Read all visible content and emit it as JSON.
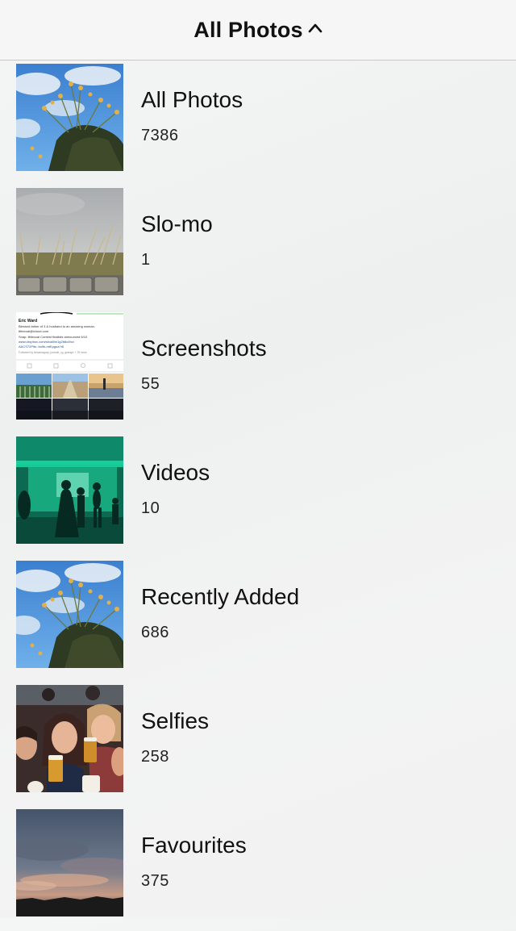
{
  "header": {
    "title": "All Photos",
    "chevron_icon": "chevron-up-icon"
  },
  "albums": [
    {
      "name": "All Photos",
      "count": "7386",
      "thumb": "sky-flowers-thumbnail"
    },
    {
      "name": "Slo-mo",
      "count": "1",
      "thumb": "grass-wall-thumbnail"
    },
    {
      "name": "Screenshots",
      "count": "55",
      "thumb": "profile-screenshot-thumbnail"
    },
    {
      "name": "Videos",
      "count": "10",
      "thumb": "green-party-thumbnail"
    },
    {
      "name": "Recently Added",
      "count": "686",
      "thumb": "sky-flowers-thumbnail"
    },
    {
      "name": "Selfies",
      "count": "258",
      "thumb": "group-selfie-thumbnail"
    },
    {
      "name": "Favourites",
      "count": "375",
      "thumb": "sunset-clouds-thumbnail"
    }
  ],
  "screenshot_thumb_text": {
    "name": "Eric Ward",
    "bio1": "Blessed father of 3 & husband to an amazing woman.",
    "bio2": "ttttecoal@icloud.com",
    "bio3": "Snap: littlecoal Contest finalists announced 6/10",
    "link1": "www.dropbox.com/sh/a8hn1g2b8o4hc/",
    "link2": "AACS72Plbr..bu9k-mtKpgua?dl",
    "followed": "Followed by lemaniagcsy, jonhale_rg, grasspt + 75 more"
  },
  "colors": {
    "header_bg": "#f6f6f6",
    "divider": "#c8c8c8",
    "text": "#111111"
  }
}
